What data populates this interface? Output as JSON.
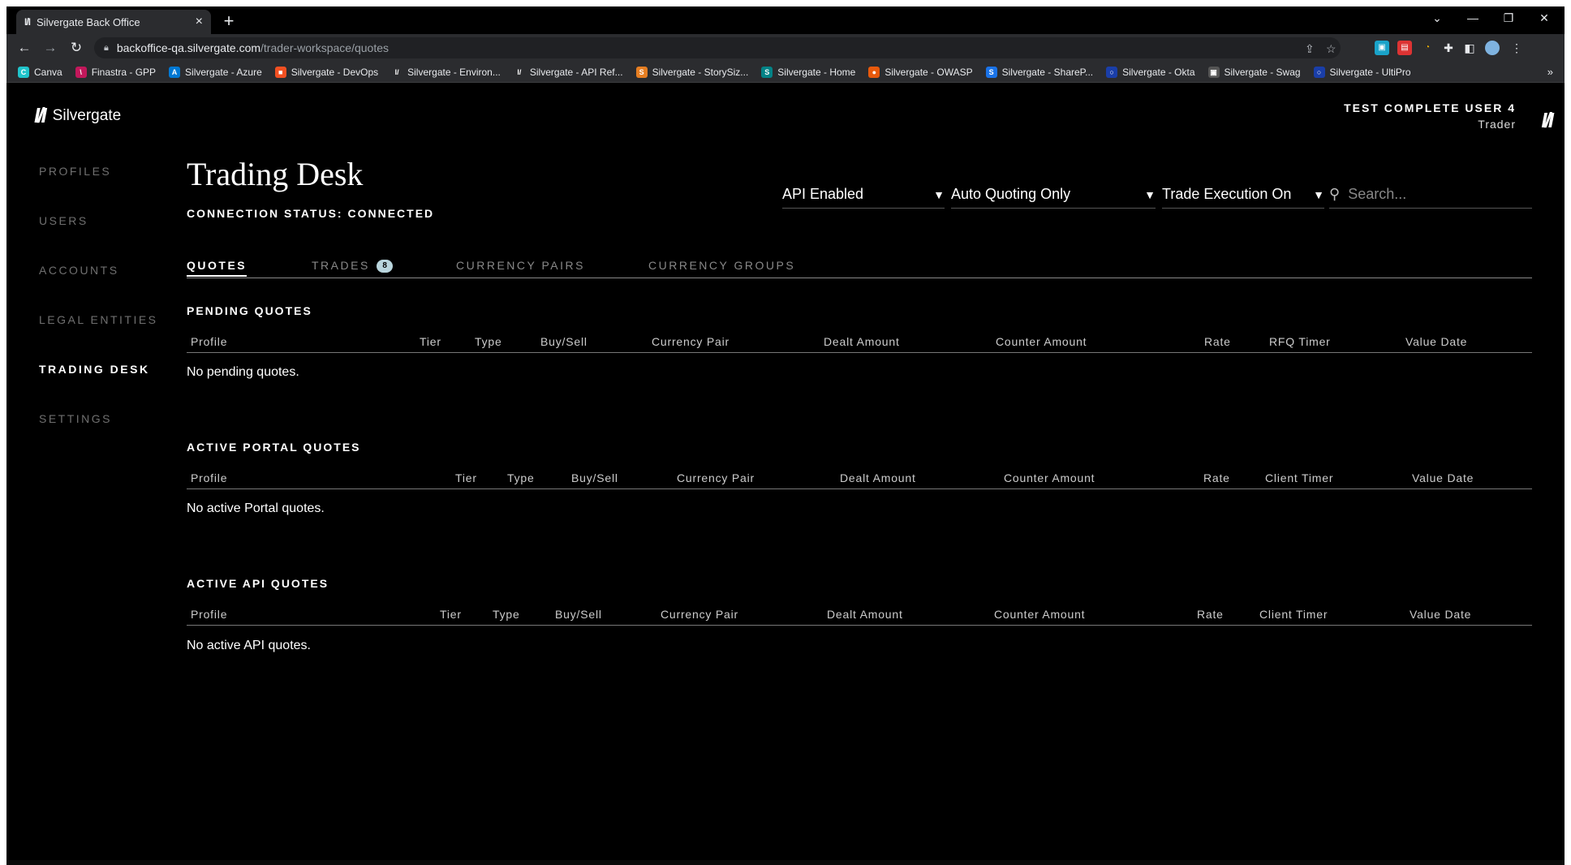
{
  "browser": {
    "tab_title": "Silvergate Back Office",
    "tab_favicon": "Ι/Ι",
    "new_tab": "+",
    "url_host": "backoffice-qa.silvergate.com",
    "url_path": "/trader-workspace/quotes",
    "bookmarks": [
      {
        "label": "Canva",
        "color": "#20c4cb",
        "glyph": "C"
      },
      {
        "label": "Finastra - GPP",
        "color": "#c2185b",
        "glyph": "\\"
      },
      {
        "label": "Silvergate - Azure",
        "color": "#0078d4",
        "glyph": "A"
      },
      {
        "label": "Silvergate - DevOps",
        "color": "#f25022",
        "glyph": "■"
      },
      {
        "label": "Silvergate - Environ...",
        "color": "#2b2c2f",
        "glyph": "Ι/"
      },
      {
        "label": "Silvergate - API Ref...",
        "color": "#2b2c2f",
        "glyph": "Ι/"
      },
      {
        "label": "Silvergate - StorySiz...",
        "color": "#e67e22",
        "glyph": "S"
      },
      {
        "label": "Silvergate - Home",
        "color": "#038387",
        "glyph": "S"
      },
      {
        "label": "Silvergate - OWASP",
        "color": "#e8590c",
        "glyph": "●"
      },
      {
        "label": "Silvergate - ShareP...",
        "color": "#1a73e8",
        "glyph": "S"
      },
      {
        "label": "Silvergate - Okta",
        "color": "#1a3ea8",
        "glyph": "○"
      },
      {
        "label": "Silvergate - Swag",
        "color": "#555",
        "glyph": "▣"
      },
      {
        "label": "Silvergate - UltiPro",
        "color": "#1a3ea8",
        "glyph": "○"
      }
    ],
    "more": "»"
  },
  "app": {
    "brand_mark": "Ι/Ι",
    "brand_name": "Silvergate",
    "nav": [
      "PROFILES",
      "USERS",
      "ACCOUNTS",
      "LEGAL ENTITIES",
      "TRADING DESK",
      "SETTINGS"
    ],
    "active_nav": "TRADING DESK",
    "user_name": "TEST COMPLETE USER 4",
    "user_role": "Trader",
    "title": "Trading Desk",
    "connection_status": "CONNECTION STATUS: CONNECTED",
    "filters": {
      "api": "API Enabled",
      "quoting": "Auto Quoting Only",
      "execution": "Trade Execution On",
      "search_placeholder": "Search..."
    },
    "tabs": {
      "quotes": "QUOTES",
      "trades": "TRADES",
      "trades_count": "8",
      "currency_pairs": "CURRENCY PAIRS",
      "currency_groups": "CURRENCY GROUPS"
    },
    "pending": {
      "title": "PENDING QUOTES",
      "columns": [
        "Profile",
        "Tier",
        "Type",
        "Buy/Sell",
        "Currency Pair",
        "Dealt Amount",
        "Counter Amount",
        "Rate",
        "RFQ Timer",
        "Value Date"
      ],
      "empty": "No pending quotes."
    },
    "portal": {
      "title": "ACTIVE PORTAL QUOTES",
      "columns": [
        "Profile",
        "Tier",
        "Type",
        "Buy/Sell",
        "Currency Pair",
        "Dealt Amount",
        "Counter Amount",
        "Rate",
        "Client Timer",
        "Value Date"
      ],
      "empty": "No active Portal quotes."
    },
    "api": {
      "title": "ACTIVE API QUOTES",
      "columns": [
        "Profile",
        "Tier",
        "Type",
        "Buy/Sell",
        "Currency Pair",
        "Dealt Amount",
        "Counter Amount",
        "Rate",
        "Client Timer",
        "Value Date"
      ],
      "empty": "No active API quotes."
    }
  }
}
